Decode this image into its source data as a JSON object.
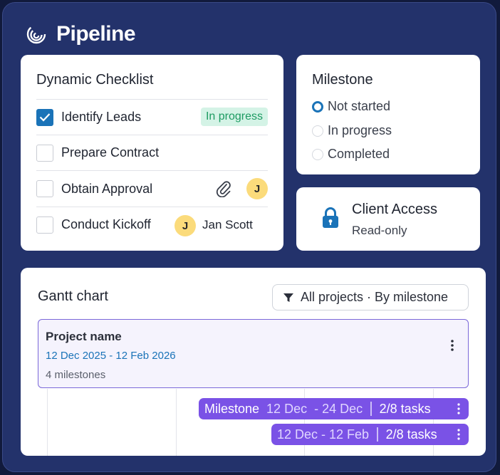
{
  "app": {
    "title": "Pipeline"
  },
  "checklist": {
    "title": "Dynamic Checklist",
    "items": [
      {
        "label": "Identify Leads",
        "checked": true,
        "badge": "In progress"
      },
      {
        "label": "Prepare Contract",
        "checked": false
      },
      {
        "label": "Obtain Approval",
        "checked": false,
        "attachment_icon": "paperclip-icon",
        "avatar": "J"
      },
      {
        "label": "Conduct Kickoff",
        "checked": false,
        "avatar": "J",
        "assignee": "Jan Scott"
      }
    ]
  },
  "milestone": {
    "title": "Milestone",
    "options": [
      {
        "label": "Not started",
        "selected": true
      },
      {
        "label": "In progress",
        "selected": false
      },
      {
        "label": "Completed",
        "selected": false
      }
    ]
  },
  "client_access": {
    "title": "Client Access",
    "status": "Read-only",
    "icon": "lock-icon"
  },
  "gantt": {
    "title": "Gantt chart",
    "filter_label": "All projects · By milestone",
    "project": {
      "name": "Project name",
      "dates": "12 Dec 2025 - 12 Feb 2026",
      "milestones": "4 milestones"
    },
    "bars": [
      {
        "name": "Milestone",
        "start": "12 Dec",
        "end": "- 24 Dec",
        "tasks": "2/8 tasks"
      },
      {
        "range": "12 Dec - 12 Feb",
        "tasks": "2/8 tasks"
      }
    ]
  },
  "colors": {
    "accent": "#1a73b8",
    "bar": "#7a52e6",
    "background": "#23326b",
    "badge_bg": "#d4f3e6",
    "badge_text": "#1d9b62"
  }
}
